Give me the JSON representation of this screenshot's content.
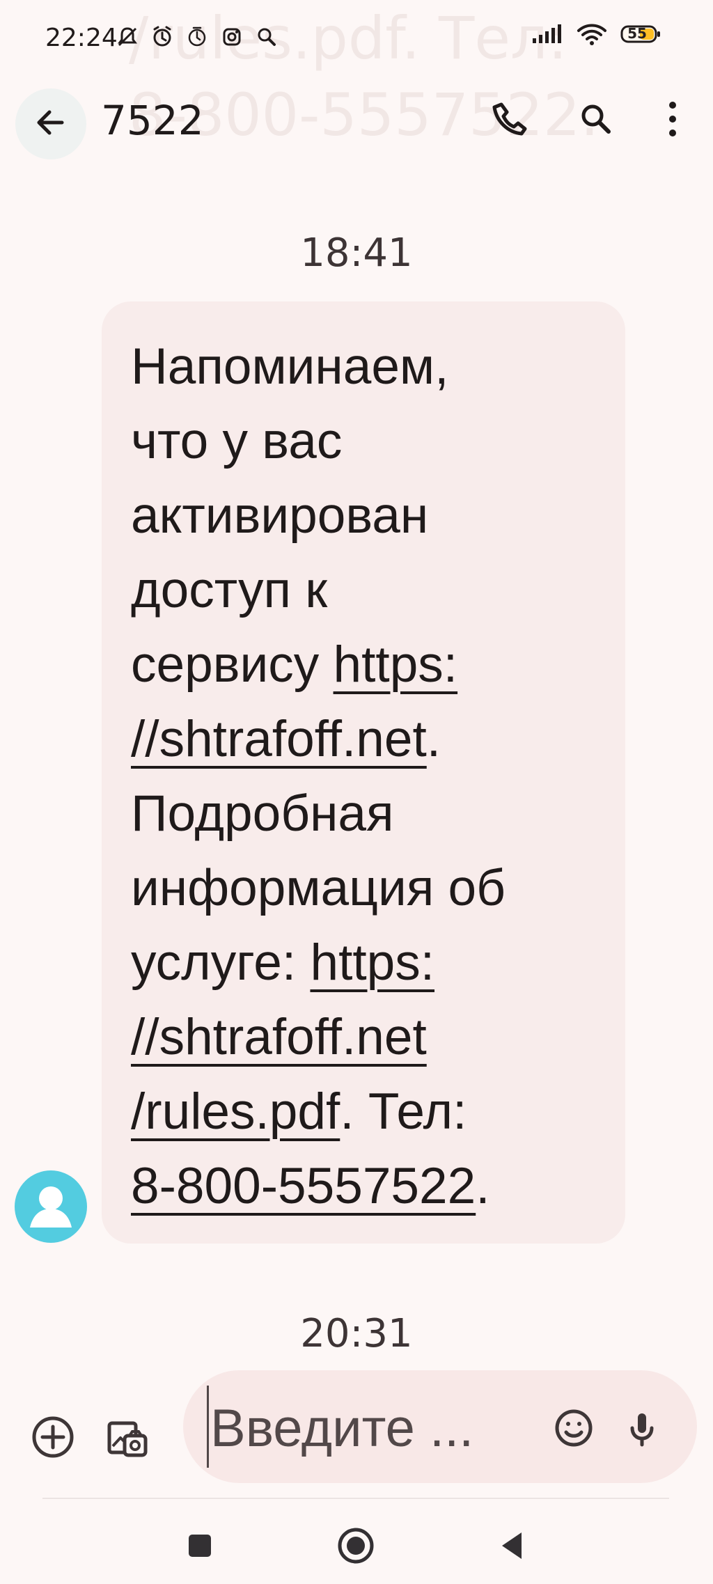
{
  "status_bar": {
    "time": "22:24",
    "battery": "55",
    "icons": [
      "muted-notification-icon",
      "alarm-icon",
      "timer-icon",
      "instagram-icon",
      "search-icon",
      "signal-icon",
      "wifi-icon",
      "battery-icon"
    ]
  },
  "background_overlay": {
    "line1": "/rules.pdf. Тел:",
    "line2": "8-800-5557522."
  },
  "header": {
    "contact": "7522",
    "back_icon": "arrow-left-icon",
    "call_icon": "phone-icon",
    "search_icon": "search-icon",
    "more_icon": "more-vertical-icon"
  },
  "conversation": {
    "first_timestamp": "18:41",
    "second_timestamp": "20:31",
    "message": {
      "line1": "Напоминаем,",
      "line2": "что у вас",
      "line3": "активирован",
      "line4": "доступ к",
      "line5_prefix": "сервису ",
      "line5_link": "https:",
      "line6_link": "//shtrafoff.net",
      "line6_suffix": ".",
      "line7": "Подробная",
      "line8": "информация об",
      "line9_prefix": "услуге: ",
      "line9_link": "https:",
      "line10_link": "//shtrafoff.net",
      "line11_link": "/rules.pdf",
      "line11_suffix": ". Тел:",
      "line12_link": "8-800-5557522",
      "line12_suffix": "."
    }
  },
  "composer": {
    "placeholder": "Введите ...",
    "add_icon": "add-circle-icon",
    "gallery_icon": "camera-gallery-icon",
    "emoji_icon": "emoji-icon",
    "mic_icon": "microphone-icon"
  },
  "navigation": {
    "recent_icon": "recent-apps-icon",
    "home_icon": "home-icon",
    "back_icon": "back-triangle-icon"
  },
  "colors": {
    "background": "#fdf7f6",
    "bubble": "#f8eceb",
    "input": "#f8e8e7",
    "avatar": "#53cce0",
    "text": "#1f1a1a",
    "battery": "#ffbf24"
  }
}
